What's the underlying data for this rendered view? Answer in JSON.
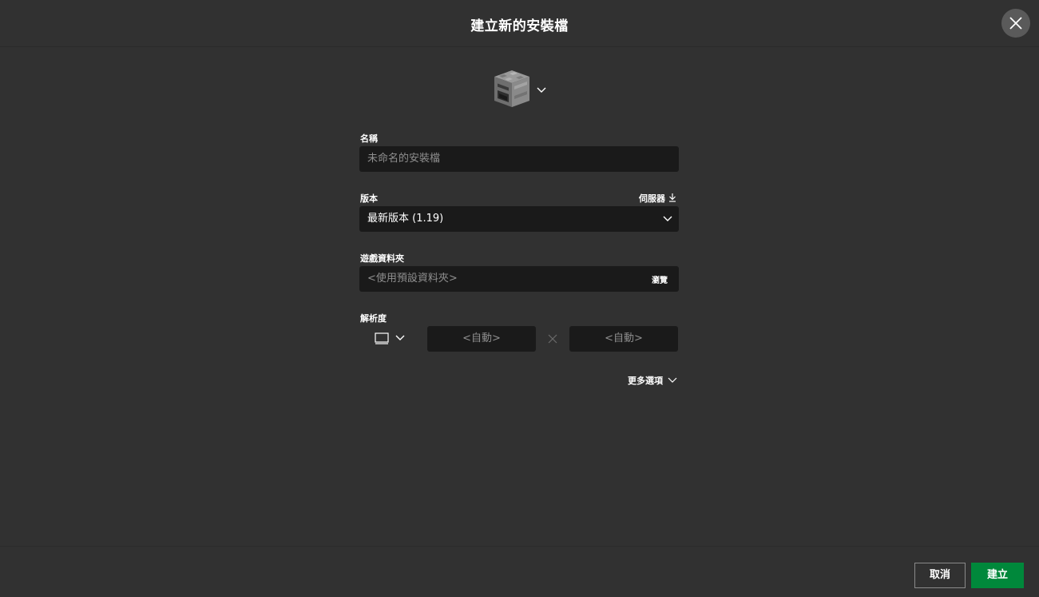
{
  "dialog": {
    "title": "建立新的安裝檔"
  },
  "icon_picker": {
    "icon": "furnace-block-icon"
  },
  "name_field": {
    "label": "名稱",
    "placeholder": "未命名的安裝檔"
  },
  "version_field": {
    "label": "版本",
    "server_link": "伺服器",
    "selected": "最新版本 (1.19)"
  },
  "game_dir_field": {
    "label": "遊戲資料夾",
    "placeholder": "<使用預設資料夾>",
    "browse_label": "瀏覽"
  },
  "resolution": {
    "label": "解析度",
    "width_placeholder": "<自動>",
    "height_placeholder": "<自動>"
  },
  "more_options_label": "更多選項",
  "footer": {
    "cancel_label": "取消",
    "create_label": "建立"
  },
  "colors": {
    "background": "#313131",
    "input_background": "#1a1a1a",
    "primary_button": "#00883b",
    "close_button": "#5a5a5a"
  }
}
